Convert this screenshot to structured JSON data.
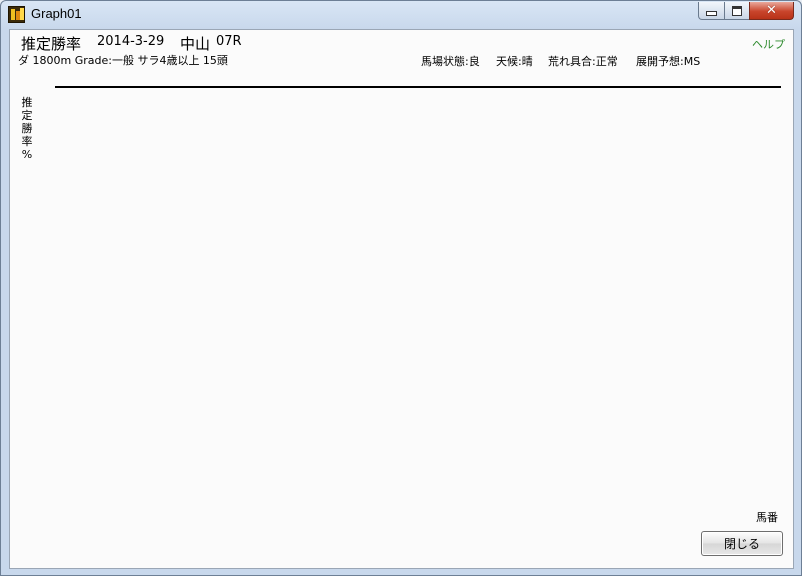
{
  "window": {
    "title": "Graph01",
    "controls": {
      "minimize": "minimize",
      "maximize": "maximize",
      "close": "✕"
    }
  },
  "header": {
    "title": "推定勝率",
    "date": "2014-3-29",
    "course": "中山",
    "race_no": "07R",
    "race_info": "ダ 1800m  Grade:一般 サラ4歳以上  15頭",
    "conditions": {
      "track": "馬場状態:良",
      "weather": "天候:晴",
      "roughness": "荒れ具合:正常",
      "pace_forecast": "展開予想:MS"
    },
    "help": "ヘルプ"
  },
  "chart": {
    "y_label_chars": [
      "推",
      "定",
      "勝",
      "率",
      "%"
    ],
    "x_label": "馬番"
  },
  "footer": {
    "close_label": "閉じる"
  },
  "icons": {
    "app": "graph-app-icon"
  }
}
